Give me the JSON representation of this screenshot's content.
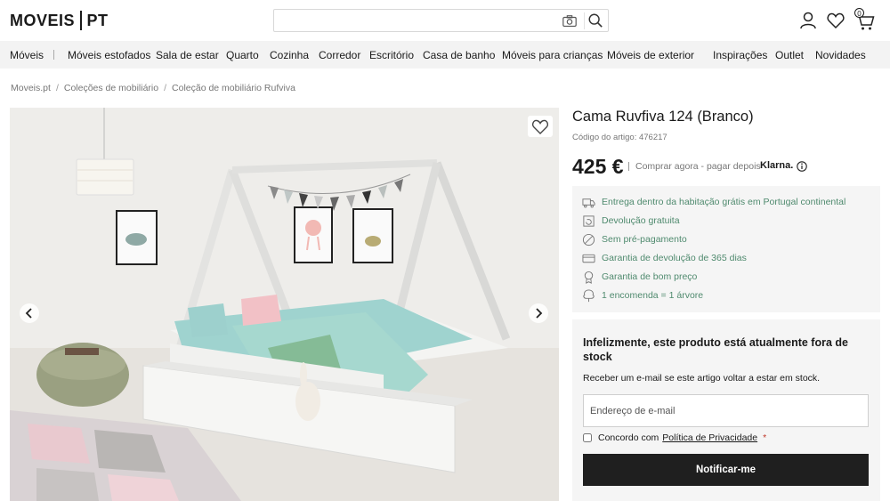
{
  "header": {
    "logo_left": "MOVEIS",
    "logo_right": "PT",
    "search_placeholder": "",
    "cart_count": "0"
  },
  "nav": {
    "items": [
      "Móveis",
      "Móveis estofados",
      "Sala de estar",
      "Quarto",
      "Cozinha",
      "Corredor",
      "Escritório",
      "Casa de banho",
      "Móveis para crianças",
      "Móveis de exterior",
      "Inspirações",
      "Outlet",
      "Novidades"
    ]
  },
  "breadcrumb": [
    "Moveis.pt",
    "Coleções de mobiliário",
    "Coleção de mobiliário Rufviva"
  ],
  "product": {
    "title": "Cama Ruvfiva 124 (Branco)",
    "sku": "Código do artigo: 476217",
    "price": "425 €",
    "klarna_text": "Comprar agora - pagar depois",
    "klarna_logo": "Klarna."
  },
  "benefits": [
    {
      "icon": "truck-icon",
      "text": "Entrega dentro da habitação grátis em Portugal continental"
    },
    {
      "icon": "return-icon",
      "text": "Devolução gratuita"
    },
    {
      "icon": "no-prepayment-icon",
      "text": "Sem pré-pagamento"
    },
    {
      "icon": "card-icon",
      "text": "Garantia de devolução de 365 dias"
    },
    {
      "icon": "medal-icon",
      "text": "Garantia de bom preço"
    },
    {
      "icon": "tree-icon",
      "text": "1 encomenda = 1 árvore"
    }
  ],
  "stock": {
    "title": "Infelizmente, este produto está atualmente fora de stock",
    "subtitle": "Receber um e-mail se este artigo voltar a estar em stock.",
    "email_placeholder": "Endereço de e-mail",
    "consent_text": "Concordo com",
    "consent_link": "Política de Privacidade",
    "required_mark": "*",
    "button_label": "Notificar-me"
  },
  "colors": {
    "accent_green": "#4f8a6e",
    "button_dark": "#1f1f1f",
    "nav_bg": "#f3f3f3",
    "panel_bg": "#f5f5f5"
  }
}
